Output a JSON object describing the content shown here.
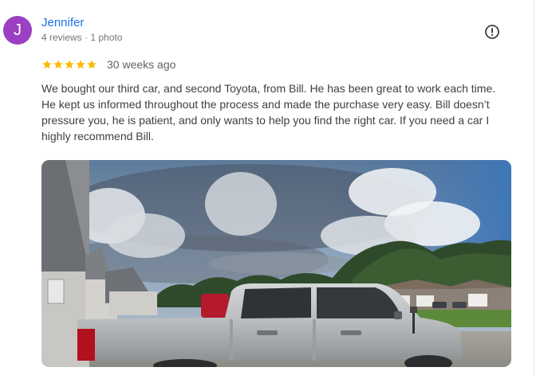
{
  "reviewer": {
    "initial": "J",
    "name": "Jennifer",
    "meta": "4 reviews · 1 photo",
    "avatar_color": "#9c3fc3"
  },
  "review": {
    "rating": 5,
    "date": "30 weeks ago",
    "text": "We bought our third car, and second Toyota, from Bill. He has been great to work each time. He kept us informed throughout the process and made the purchase very easy. Bill doesn’t pressure you, he is patient, and only wants to help you find the right car. If you need a car I highly recommend Bill.",
    "star_color": "#fbbc04"
  },
  "icons": {
    "report": "report-icon",
    "star": "star-icon"
  },
  "accent_color": "#1a73e8"
}
